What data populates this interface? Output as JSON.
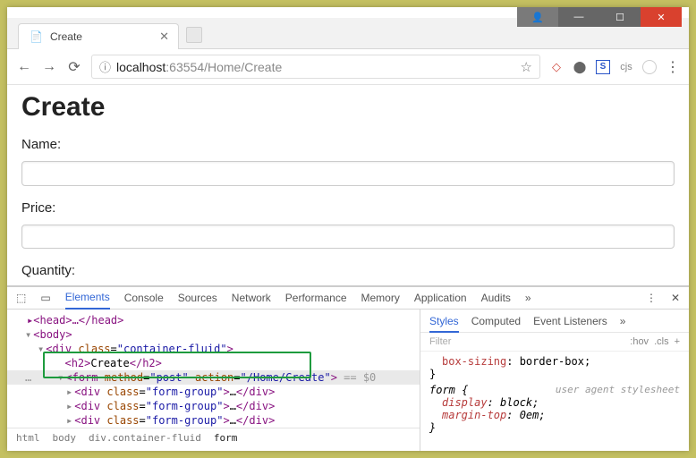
{
  "window": {
    "user_btn": "👤",
    "min_btn": "—",
    "max_btn": "☐",
    "close_btn": "✕"
  },
  "tab": {
    "favicon": "📄",
    "title": "Create",
    "close": "✕"
  },
  "nav": {
    "back": "←",
    "forward": "→",
    "reload": "⟳",
    "info": "ⓘ",
    "host": "localhost",
    "port": ":63554",
    "path": "/Home/Create",
    "star": "☆",
    "ext_ruby": "◇",
    "ext_globe": "⬤",
    "ext_s": "S",
    "ext_cjs": "cjs",
    "ext_rec": " ",
    "menu": "⋮"
  },
  "page": {
    "heading": "Create",
    "name_label": "Name:",
    "price_label": "Price:",
    "quantity_label": "Quantity:"
  },
  "devtools": {
    "inspect_icon": "⬚",
    "device_icon": "▭",
    "tabs": {
      "elements": "Elements",
      "console": "Console",
      "sources": "Sources",
      "network": "Network",
      "performance": "Performance",
      "memory": "Memory",
      "application": "Application",
      "audits": "Audits",
      "more": "»"
    },
    "menu": "⋮",
    "close": "✕",
    "dom": {
      "l1": "▸<head>…</head>",
      "l2_caret": "▾",
      "l2a": "<",
      "l2b": "body",
      "l2c": ">",
      "l3_caret": "▾",
      "l3a": "<",
      "l3b": "div",
      "l3_attr": "class",
      "l3_val": "\"container-fluid\"",
      "l3c": ">",
      "l4a": "<",
      "l4b": "h2",
      "l4c": ">",
      "l4t": "Create",
      "l4d": "</",
      "l4e": "h2",
      "l4f": ">",
      "dots": "…",
      "l5_caret": "▾",
      "l5a": "<",
      "l5b": "form",
      "l5_m": "method",
      "l5_mv": "\"post\"",
      "l5_ac": "action",
      "l5_av": "\"/Home/Create\"",
      "l5c": ">",
      "l5_eq": " == $0",
      "fg_caret": "▸",
      "fg_a": "<",
      "fg_b": "div",
      "fg_attr": "class",
      "fg_val": "\"form-group\"",
      "fg_c": ">",
      "fg_dots": "…",
      "fg_d": "</",
      "fg_e": "div",
      "fg_f": ">"
    },
    "breadcrumb": {
      "a": "html",
      "b": "body",
      "c": "div.container-fluid",
      "d": "form"
    },
    "right": {
      "styles": "Styles",
      "computed": "Computed",
      "listeners": "Event Listeners",
      "more": "»",
      "filter": "Filter",
      "hov": ":hov",
      "cls": ".cls",
      "plus": "+",
      "r1a": "box-sizing",
      "r1b": ": border-box;",
      "brace_close": "}",
      "r2_sel": "form {",
      "uas": "user agent stylesheet",
      "r2a": "display",
      "r2av": ": block;",
      "r2b": "margin-top",
      "r2bv": ": 0em;"
    }
  }
}
